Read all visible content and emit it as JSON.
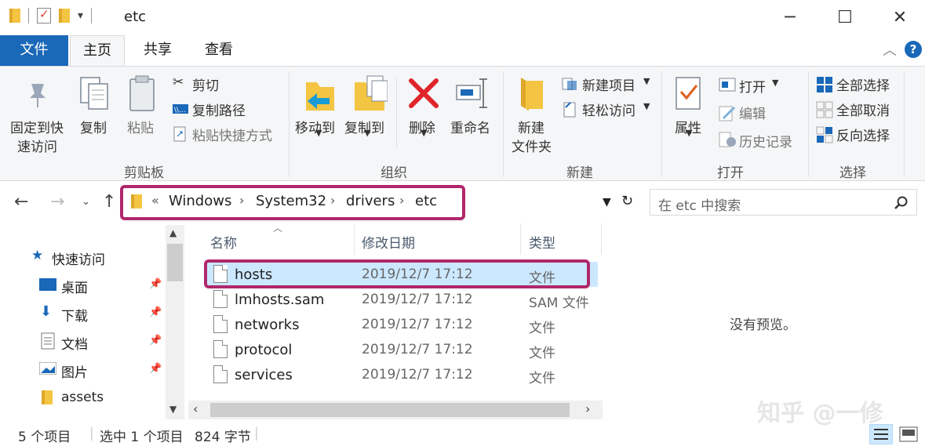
{
  "window": {
    "title": "etc",
    "controls": {
      "minimize": "─",
      "maximize": "☐",
      "close": "✕"
    }
  },
  "tabs": {
    "file": "文件",
    "home": "主页",
    "share": "共享",
    "view": "查看"
  },
  "ribbon": {
    "clipboard": {
      "group_label": "剪贴板",
      "pin_quick": [
        "固定到快",
        "速访问"
      ],
      "copy": "复制",
      "paste": "粘贴",
      "cut": "剪切",
      "copy_path": "复制路径",
      "paste_shortcut": "粘贴快捷方式"
    },
    "organize": {
      "group_label": "组织",
      "move_to": "移动到",
      "copy_to": "复制到",
      "delete": "删除",
      "rename": "重命名"
    },
    "new": {
      "group_label": "新建",
      "new_folder": [
        "新建",
        "文件夹"
      ],
      "new_item": "新建项目",
      "easy_access": "轻松访问"
    },
    "open": {
      "group_label": "打开",
      "properties": "属性",
      "open": "打开",
      "edit": "编辑",
      "history": "历史记录"
    },
    "select": {
      "group_label": "选择",
      "select_all": "全部选择",
      "select_none": "全部取消",
      "invert": "反向选择"
    }
  },
  "address": {
    "overflow": "«",
    "crumbs": [
      "Windows",
      "System32",
      "drivers",
      "etc"
    ]
  },
  "search": {
    "placeholder": "在 etc 中搜索"
  },
  "sidebar": {
    "quick_access": "快速访问",
    "items": [
      "桌面",
      "下载",
      "文档",
      "图片",
      "assets"
    ]
  },
  "columns": {
    "name": "名称",
    "modified": "修改日期",
    "type": "类型"
  },
  "files": [
    {
      "name": "hosts",
      "modified": "2019/12/7 17:12",
      "type": "文件"
    },
    {
      "name": "lmhosts.sam",
      "modified": "2019/12/7 17:12",
      "type": "SAM 文件"
    },
    {
      "name": "networks",
      "modified": "2019/12/7 17:12",
      "type": "文件"
    },
    {
      "name": "protocol",
      "modified": "2019/12/7 17:12",
      "type": "文件"
    },
    {
      "name": "services",
      "modified": "2019/12/7 17:12",
      "type": "文件"
    }
  ],
  "preview": {
    "empty_text": "没有预览。"
  },
  "watermark": "知乎 @一修",
  "status": {
    "count": "5 个项目",
    "selected": "选中 1 个项目",
    "size": "824 字节"
  },
  "colors": {
    "accent": "#1a68b8",
    "highlight": "#b0276b",
    "selection": "#cce8ff"
  }
}
